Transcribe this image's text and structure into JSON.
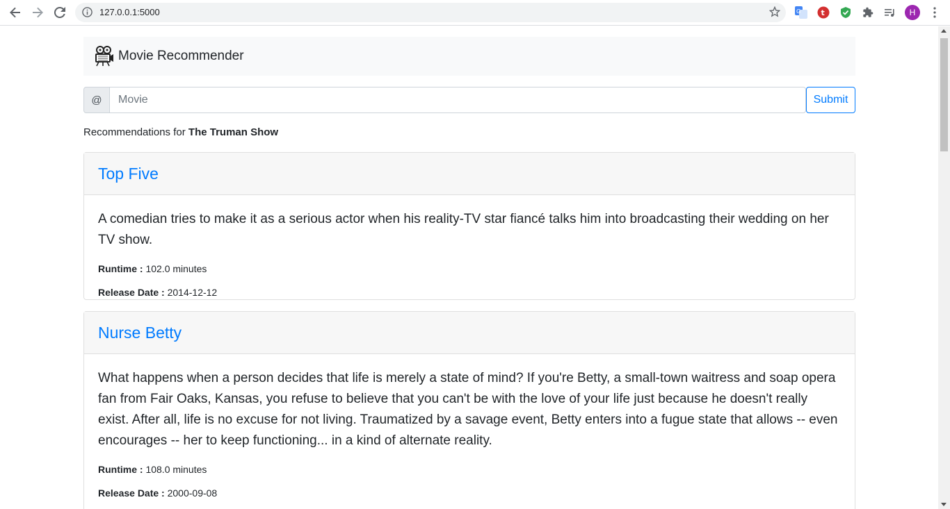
{
  "browser": {
    "url": "127.0.0.1:5000",
    "avatar_letter": "H"
  },
  "app": {
    "brand": "Movie Recommender"
  },
  "search": {
    "prefix": "@",
    "placeholder": "Movie",
    "submit_label": "Submit"
  },
  "recommendations": {
    "prefix": "Recommendations for",
    "movie": "The Truman Show"
  },
  "labels": {
    "runtime": "Runtime :",
    "release": "Release Date :"
  },
  "movies": [
    {
      "title": "Top Five",
      "overview": "A comedian tries to make it as a serious actor when his reality-TV star fiancé talks him into broadcasting their wedding on her TV show.",
      "runtime": "102.0 minutes",
      "release_date": "2014-12-12"
    },
    {
      "title": "Nurse Betty",
      "overview": "What happens when a person decides that life is merely a state of mind? If you're Betty, a small-town waitress and soap opera fan from Fair Oaks, Kansas, you refuse to believe that you can't be with the love of your life just because he doesn't really exist. After all, life is no excuse for not living. Traumatized by a savage event, Betty enters into a fugue state that allows -- even encourages -- her to keep functioning... in a kind of alternate reality.",
      "runtime": "108.0 minutes",
      "release_date": "2000-09-08"
    }
  ],
  "colors": {
    "link": "#007bff",
    "avatar": "#9c27b0"
  }
}
